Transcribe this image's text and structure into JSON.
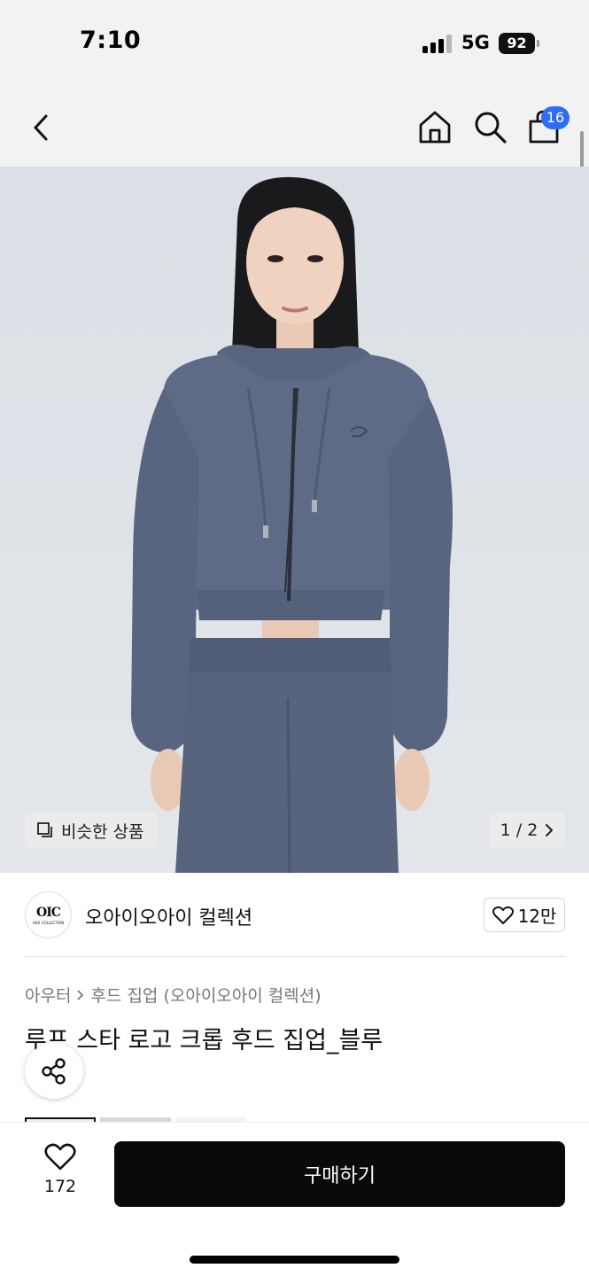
{
  "status_bar": {
    "time": "7:10",
    "network": "5G",
    "battery": "92"
  },
  "header": {
    "cart_count": "16"
  },
  "image": {
    "similar_label": "비슷한 상품",
    "pager": "1 / 2"
  },
  "brand": {
    "logo_text": "OIC",
    "logo_subtext": "OIOI COLLECTION",
    "name": "오아이오아이 컬렉션",
    "likes": "12만"
  },
  "breadcrumb": {
    "category": "아우터",
    "subcategory": "후드 집업 (오아이오아이 컬렉션)"
  },
  "product": {
    "title": "루프 스타 로고 크롭 후드 집업_블루"
  },
  "bottom_bar": {
    "wish_count": "172",
    "buy_label": "구매하기"
  },
  "colors": {
    "accent_blue": "#2d6cf5",
    "buy_button": "#0a0a0a",
    "garment": "#5e6a86",
    "backdrop": "#dfe3e8"
  },
  "icons": [
    "back-icon",
    "home-icon",
    "search-icon",
    "cart-icon",
    "copy-icon",
    "chevron-right-icon",
    "heart-icon",
    "share-icon"
  ]
}
